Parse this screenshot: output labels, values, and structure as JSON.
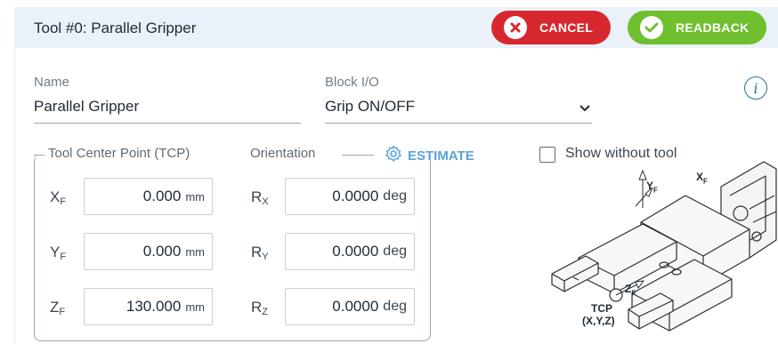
{
  "header": {
    "title": "Tool #0: Parallel Gripper",
    "cancel_label": "CANCEL",
    "readback_label": "READBACK",
    "cancel_color": "#d8282f",
    "readback_color": "#6fbf2f"
  },
  "form": {
    "name_label": "Name",
    "name_value": "Parallel Gripper",
    "block_io_label": "Block I/O",
    "block_io_value": "Grip ON/OFF",
    "info_icon": "i"
  },
  "tcp": {
    "section_title": "Tool Center Point (TCP)",
    "orientation_title": "Orientation",
    "estimate_label": "ESTIMATE",
    "show_without_tool_label": "Show without tool",
    "show_without_tool_checked": false,
    "position": [
      {
        "axis": "X",
        "sub": "F",
        "value": "0.000",
        "unit": "mm"
      },
      {
        "axis": "Y",
        "sub": "F",
        "value": "0.000",
        "unit": "mm"
      },
      {
        "axis": "Z",
        "sub": "F",
        "value": "130.000",
        "unit": "mm"
      }
    ],
    "rotation": [
      {
        "axis": "R",
        "sub": "X",
        "value": "0.0000",
        "unit": "deg"
      },
      {
        "axis": "R",
        "sub": "Y",
        "value": "0.0000",
        "unit": "deg"
      },
      {
        "axis": "R",
        "sub": "Z",
        "value": "0.0000",
        "unit": "deg"
      }
    ]
  },
  "diagram": {
    "yf_label": "Y",
    "yf_sub": "F",
    "xf_label": "X",
    "xf_sub": "F",
    "zf_label": "Z",
    "zf_sub": "F",
    "tcp_label": "TCP",
    "tcp_coords": "(X,Y,Z)"
  }
}
